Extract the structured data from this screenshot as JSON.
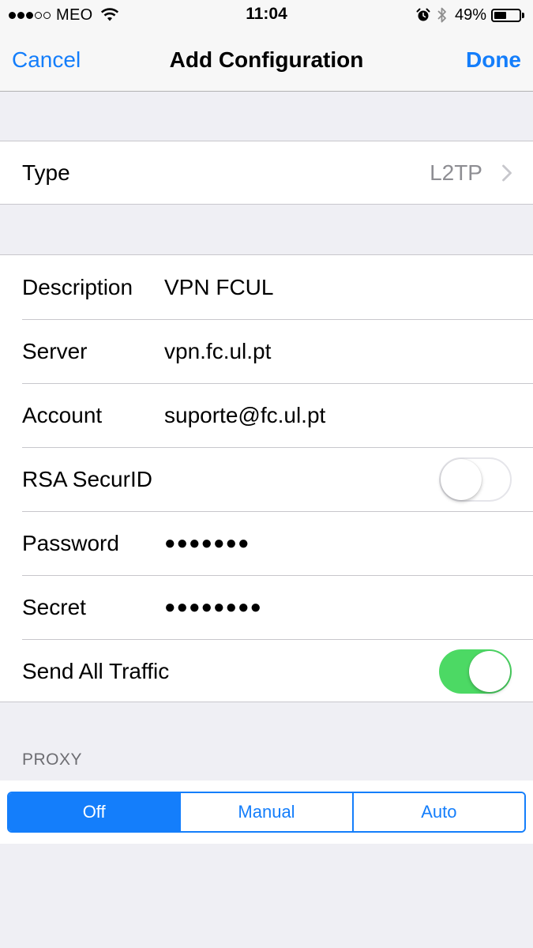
{
  "status_bar": {
    "carrier": "MEO",
    "signal_bars_filled": 3,
    "signal_bars_total": 5,
    "time": "11:04",
    "battery_percent": "49%",
    "battery_level": 0.49,
    "icons": [
      "wifi-icon",
      "alarm-icon",
      "bluetooth-icon",
      "battery-icon"
    ]
  },
  "nav": {
    "cancel_label": "Cancel",
    "title": "Add Configuration",
    "done_label": "Done"
  },
  "type_row": {
    "label": "Type",
    "value": "L2TP"
  },
  "fields": {
    "description": {
      "label": "Description",
      "value": "VPN FCUL"
    },
    "server": {
      "label": "Server",
      "value": "vpn.fc.ul.pt"
    },
    "account": {
      "label": "Account",
      "value": "suporte@fc.ul.pt"
    },
    "rsa": {
      "label": "RSA SecurID",
      "on": false
    },
    "password": {
      "label": "Password",
      "value": "●●●●●●●"
    },
    "secret": {
      "label": "Secret",
      "value": "●●●●●●●●"
    },
    "send_all_traffic": {
      "label": "Send All Traffic",
      "on": true
    }
  },
  "proxy": {
    "header": "PROXY",
    "options": [
      "Off",
      "Manual",
      "Auto"
    ],
    "selected": "Off"
  },
  "colors": {
    "accent": "#147efb",
    "toggle_on": "#4cd964",
    "background": "#efeff4",
    "secondary_text": "#8e8e93"
  }
}
